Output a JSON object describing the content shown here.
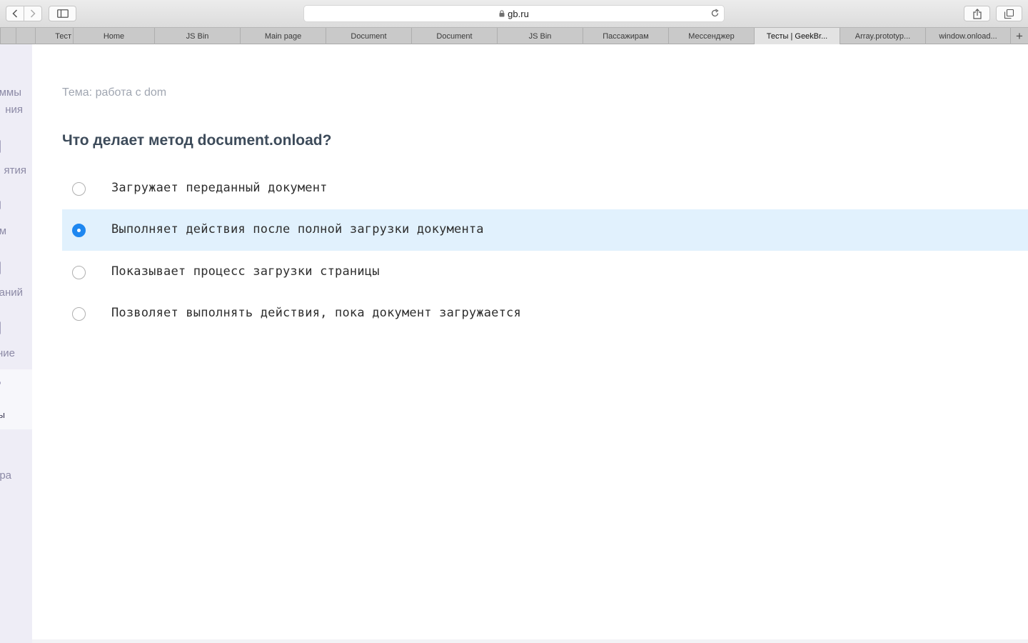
{
  "browser": {
    "url": "gb.ru",
    "tabs": [
      {
        "label": "Тест",
        "active": false
      },
      {
        "label": "Home",
        "active": false
      },
      {
        "label": "JS Bin",
        "active": false
      },
      {
        "label": "Main page",
        "active": false
      },
      {
        "label": "Document",
        "active": false
      },
      {
        "label": "Document",
        "active": false
      },
      {
        "label": "JS Bin",
        "active": false
      },
      {
        "label": "Пассажирам",
        "active": false
      },
      {
        "label": "Мессенджер",
        "active": false
      },
      {
        "label": "Тесты | GeekBr...",
        "active": true
      },
      {
        "label": "Array.prototyp...",
        "active": false
      },
      {
        "label": "window.onload...",
        "active": false
      }
    ],
    "new_tab_symbol": "+"
  },
  "left_nav": {
    "fragments": [
      "ммы",
      "ния",
      "ятия",
      "м",
      "аний",
      "ние",
      "ы",
      "ра"
    ]
  },
  "quiz": {
    "topic": "Тема: работа с dom",
    "question": "Что делает метод document.onload?",
    "options": [
      {
        "label": "Загружает переданный документ",
        "selected": false
      },
      {
        "label": "Выполняет действия после полной загрузки документа",
        "selected": true
      },
      {
        "label": "Показывает процесс загрузки страницы",
        "selected": false
      },
      {
        "label": "Позволяет выполнять действия, пока документ загружается",
        "selected": false
      }
    ]
  },
  "colors": {
    "accent": "#1e87f0",
    "selected_row": "#e1f1fd",
    "question_text": "#3d4b5a",
    "topic_text": "#a0a6b1",
    "sidebar_bg": "#eeedf6"
  }
}
